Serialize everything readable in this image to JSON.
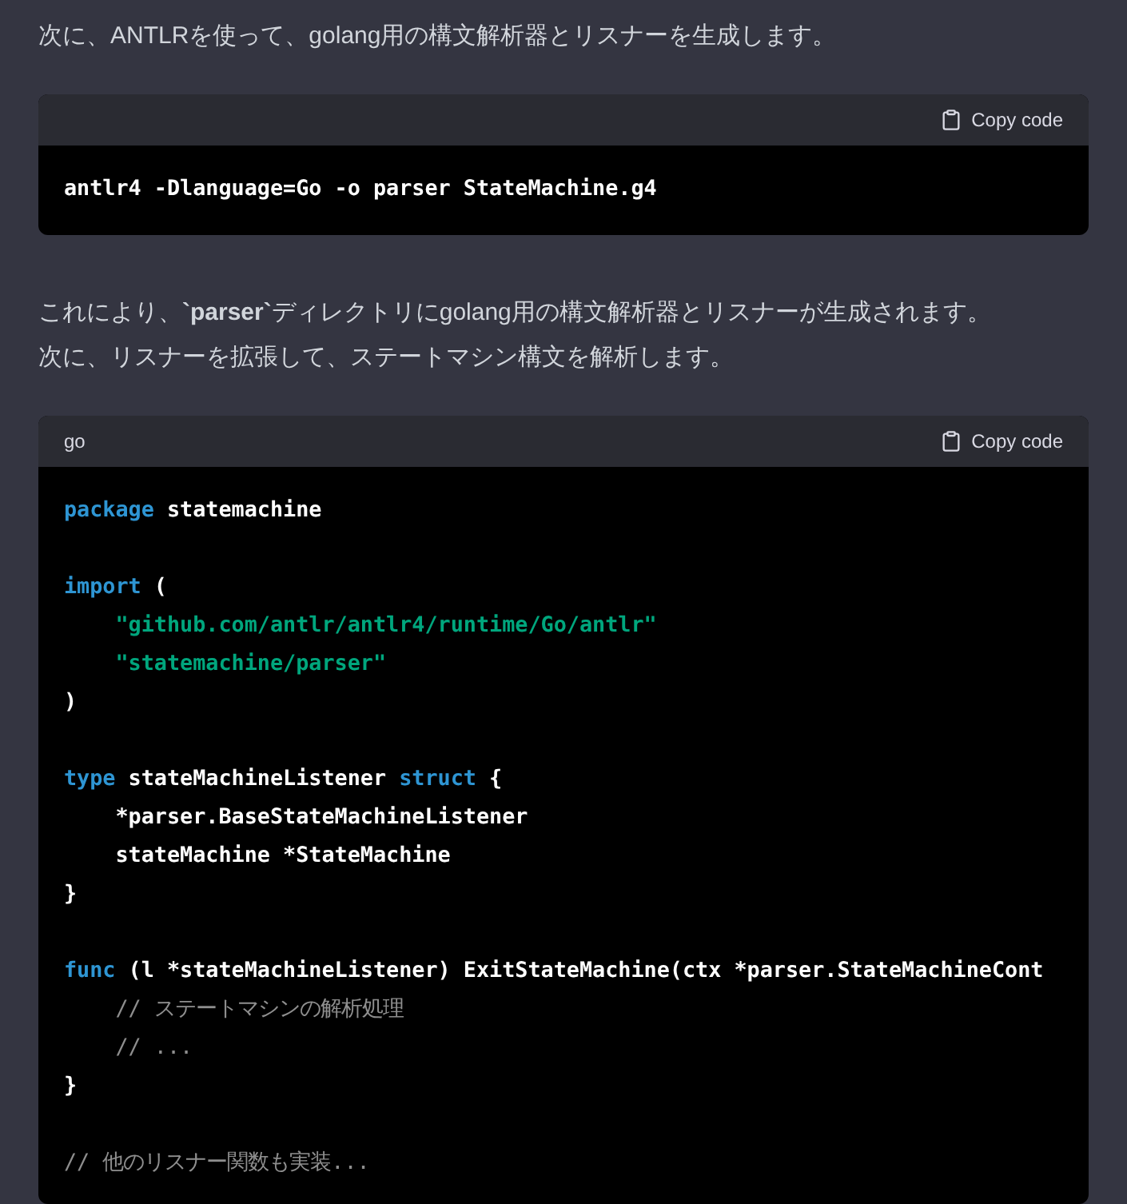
{
  "blocks": [
    {
      "kind": "paragraph",
      "lines": [
        "次に、ANTLRを使って、golang用の構文解析器とリスナーを生成します。"
      ]
    },
    {
      "kind": "code",
      "copy_label": "Copy code",
      "lines": [
        {
          "kind": "code",
          "tokens": [
            {
              "kind": "plain",
              "text": "antlr4 -Dlanguage=Go -o parser StateMachine.g4"
            }
          ]
        }
      ]
    },
    {
      "kind": "paragraph",
      "lines": [
        "これにより、**`parser`**ディレクトリにgolang用の構文解析器とリスナーが生成されます。",
        "次に、リスナーを拡張して、ステートマシン構文を解析します。"
      ]
    },
    {
      "kind": "code",
      "language": "go",
      "copy_label": "Copy code",
      "lines": [
        {
          "kind": "code",
          "tokens": [
            {
              "kind": "keyword",
              "text": "package"
            },
            {
              "kind": "plain",
              "text": " statemachine"
            }
          ]
        },
        {
          "kind": "blank"
        },
        {
          "kind": "code",
          "tokens": [
            {
              "kind": "keyword",
              "text": "import"
            },
            {
              "kind": "plain",
              "text": " ("
            }
          ]
        },
        {
          "kind": "code",
          "tokens": [
            {
              "kind": "string",
              "text": "    \"github.com/antlr/antlr4/runtime/Go/antlr\""
            }
          ]
        },
        {
          "kind": "code",
          "tokens": [
            {
              "kind": "string",
              "text": "    \"statemachine/parser\""
            }
          ]
        },
        {
          "kind": "code",
          "tokens": [
            {
              "kind": "plain",
              "text": ")"
            }
          ]
        },
        {
          "kind": "blank"
        },
        {
          "kind": "code",
          "tokens": [
            {
              "kind": "keyword",
              "text": "type"
            },
            {
              "kind": "plain",
              "text": " stateMachineListener "
            },
            {
              "kind": "keyword",
              "text": "struct"
            },
            {
              "kind": "plain",
              "text": " {"
            }
          ]
        },
        {
          "kind": "code",
          "tokens": [
            {
              "kind": "plain",
              "text": "    *parser.BaseStateMachineListener"
            }
          ]
        },
        {
          "kind": "code",
          "tokens": [
            {
              "kind": "plain",
              "text": "    stateMachine *StateMachine"
            }
          ]
        },
        {
          "kind": "code",
          "tokens": [
            {
              "kind": "plain",
              "text": "}"
            }
          ]
        },
        {
          "kind": "blank"
        },
        {
          "kind": "code",
          "tokens": [
            {
              "kind": "keyword",
              "text": "func"
            },
            {
              "kind": "plain",
              "text": " (l *stateMachineListener) ExitStateMachine(ctx *parser.StateMachineCont"
            }
          ]
        },
        {
          "kind": "code",
          "tokens": [
            {
              "kind": "comment",
              "text": "    // ステートマシンの解析処理"
            }
          ]
        },
        {
          "kind": "code",
          "tokens": [
            {
              "kind": "comment",
              "text": "    // ..."
            }
          ]
        },
        {
          "kind": "code",
          "tokens": [
            {
              "kind": "plain",
              "text": "}"
            }
          ]
        },
        {
          "kind": "blank"
        },
        {
          "kind": "code",
          "tokens": [
            {
              "kind": "comment",
              "text": "// 他のリスナー関数も実装..."
            }
          ]
        }
      ]
    }
  ]
}
